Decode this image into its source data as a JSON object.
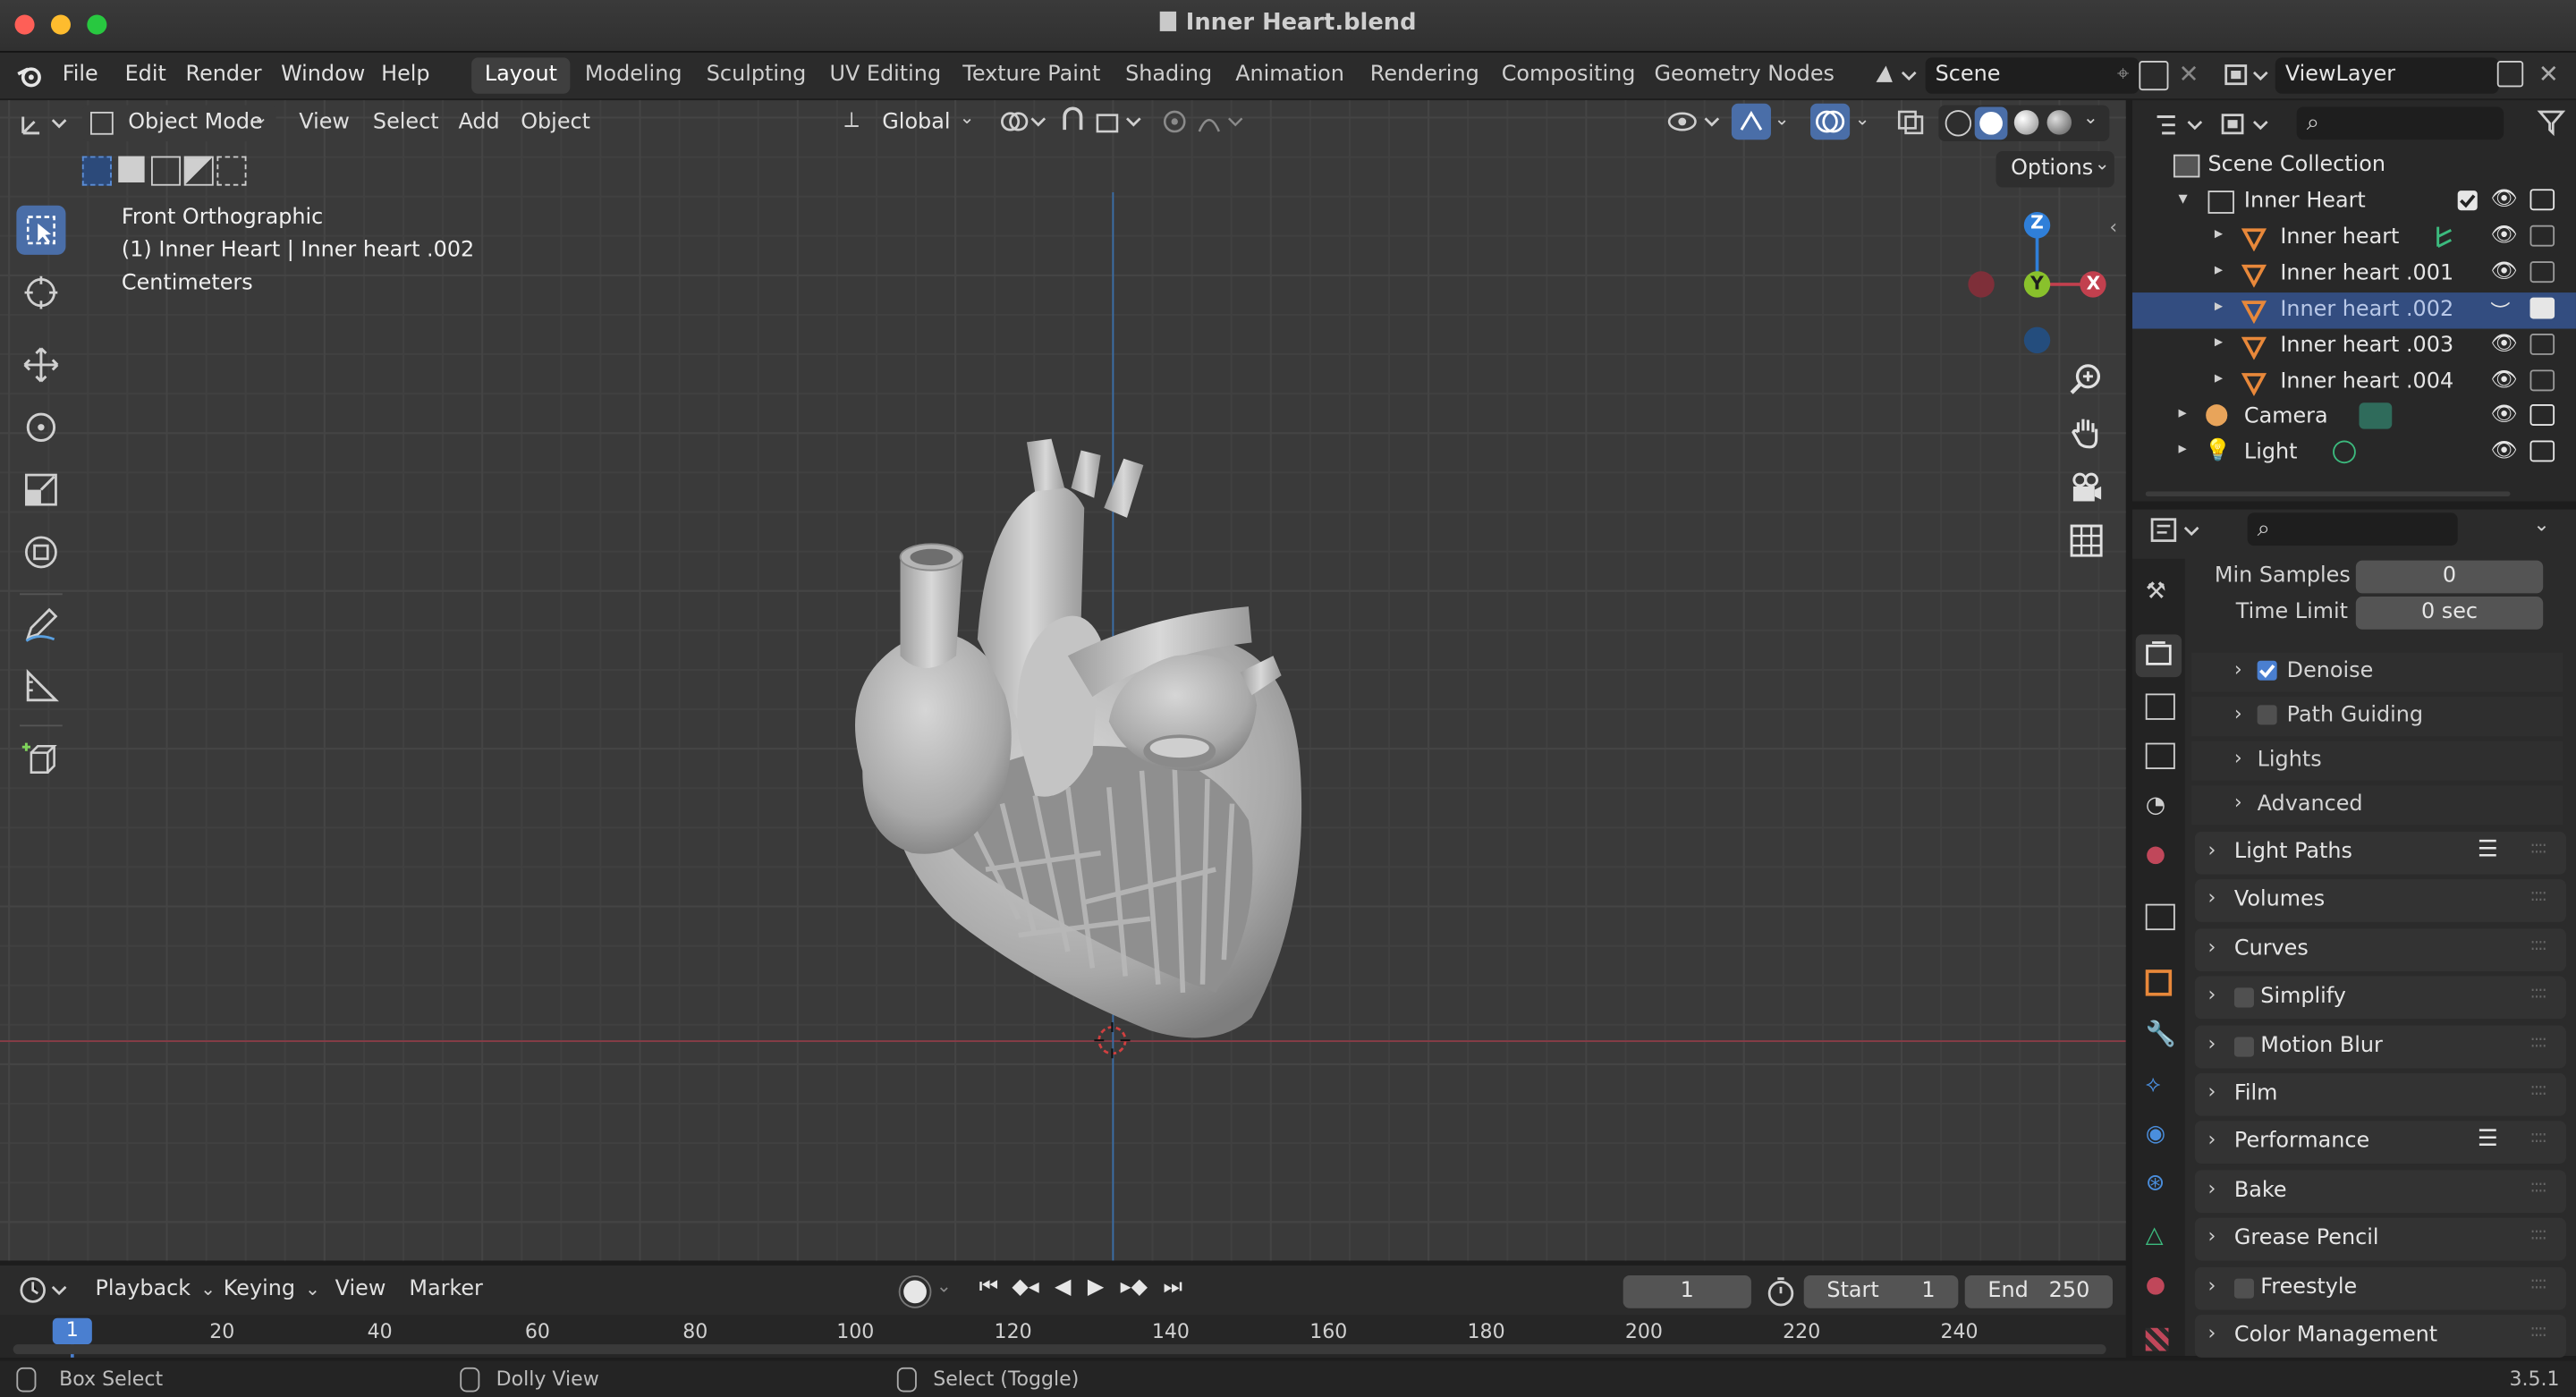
{
  "window": {
    "title": "Inner Heart.blend"
  },
  "menu": [
    "File",
    "Edit",
    "Render",
    "Window",
    "Help"
  ],
  "workspaces": [
    "Layout",
    "Modeling",
    "Sculpting",
    "UV Editing",
    "Texture Paint",
    "Shading",
    "Animation",
    "Rendering",
    "Compositing",
    "Geometry Nodes"
  ],
  "active_workspace": "Layout",
  "scene": {
    "name": "Scene",
    "view_layer": "ViewLayer"
  },
  "viewport": {
    "mode": "Object Mode",
    "menus": [
      "View",
      "Select",
      "Add",
      "Object"
    ],
    "orientation": "Global",
    "options_label": "Options",
    "overlay_lines": [
      "Front Orthographic",
      "(1) Inner Heart | Inner heart .002",
      "Centimeters"
    ],
    "gizmo_axes": {
      "z": "Z",
      "y": "Y",
      "x": "X"
    },
    "colors": {
      "x_axis": "#c2404e",
      "y_axis": "#89c12c",
      "z_axis": "#2f7fd9",
      "selection": "#4a6ea8"
    }
  },
  "outliner": {
    "root": "Scene Collection",
    "collection": "Inner Heart",
    "items": [
      "Inner heart",
      "Inner heart .001",
      "Inner heart .002",
      "Inner heart .003",
      "Inner heart .004"
    ],
    "selected_item": "Inner heart .002",
    "others": [
      "Camera",
      "Light"
    ]
  },
  "properties": {
    "fields": [
      {
        "label": "Min Samples",
        "value": "0"
      },
      {
        "label": "Time Limit",
        "value": "0 sec"
      }
    ],
    "subpanels": [
      {
        "label": "Denoise",
        "checkbox": true,
        "checked": true
      },
      {
        "label": "Path Guiding",
        "checkbox": true,
        "checked": false
      },
      {
        "label": "Lights",
        "checkbox": false
      },
      {
        "label": "Advanced",
        "checkbox": false
      }
    ],
    "panels": [
      {
        "label": "Light Paths",
        "checkbox": false,
        "presets": true
      },
      {
        "label": "Volumes",
        "checkbox": false
      },
      {
        "label": "Curves",
        "checkbox": false
      },
      {
        "label": "Simplify",
        "checkbox": true
      },
      {
        "label": "Motion Blur",
        "checkbox": true
      },
      {
        "label": "Film",
        "checkbox": false
      },
      {
        "label": "Performance",
        "checkbox": false,
        "presets": true
      },
      {
        "label": "Bake",
        "checkbox": false
      },
      {
        "label": "Grease Pencil",
        "checkbox": false
      },
      {
        "label": "Freestyle",
        "checkbox": true
      },
      {
        "label": "Color Management",
        "checkbox": false
      }
    ]
  },
  "timeline": {
    "menus": [
      "Playback",
      "Keying",
      "View",
      "Marker"
    ],
    "current_frame": "1",
    "start_label": "Start",
    "start": "1",
    "end_label": "End",
    "end": "250",
    "ticks": [
      "1",
      "20",
      "40",
      "60",
      "80",
      "100",
      "120",
      "140",
      "160",
      "180",
      "200",
      "220",
      "240"
    ]
  },
  "statusbar": {
    "items": [
      "Box Select",
      "Dolly View",
      "Select (Toggle)"
    ],
    "version": "3.5.1"
  }
}
